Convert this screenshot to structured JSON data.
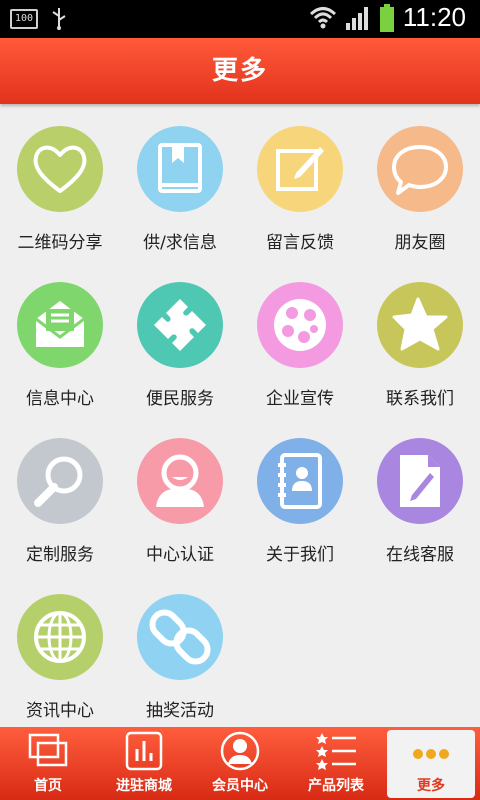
{
  "status": {
    "time": "11:20",
    "battery_small": "100"
  },
  "header": {
    "title": "更多"
  },
  "grid": [
    {
      "label": "二维码分享",
      "icon": "heart-icon",
      "color": "#b8cf6a"
    },
    {
      "label": "供/求信息",
      "icon": "book-icon",
      "color": "#8fd3f0"
    },
    {
      "label": "留言反馈",
      "icon": "edit-icon",
      "color": "#f7d57a"
    },
    {
      "label": "朋友圈",
      "icon": "chat-bubble-icon",
      "color": "#f6b98a"
    },
    {
      "label": "信息中心",
      "icon": "mail-icon",
      "color": "#7fd66c"
    },
    {
      "label": "便民服务",
      "icon": "puzzle-icon",
      "color": "#4fc8b3"
    },
    {
      "label": "企业宣传",
      "icon": "film-reel-icon",
      "color": "#f39ae0"
    },
    {
      "label": "联系我们",
      "icon": "star-icon",
      "color": "#c7c65a"
    },
    {
      "label": "定制服务",
      "icon": "magnifier-icon",
      "color": "#c3c8cf"
    },
    {
      "label": "中心认证",
      "icon": "user-icon",
      "color": "#f79ba8"
    },
    {
      "label": "关于我们",
      "icon": "contacts-icon",
      "color": "#7fb0e8"
    },
    {
      "label": "在线客服",
      "icon": "document-edit-icon",
      "color": "#a987e0"
    },
    {
      "label": "资讯中心",
      "icon": "globe-icon",
      "color": "#b5cf6a"
    },
    {
      "label": "抽奖活动",
      "icon": "link-icon",
      "color": "#8fd2f2"
    }
  ],
  "tabs": [
    {
      "label": "首页",
      "icon": "layers-icon"
    },
    {
      "label": "进驻商城",
      "icon": "bar-chart-icon"
    },
    {
      "label": "会员中心",
      "icon": "member-icon"
    },
    {
      "label": "产品列表",
      "icon": "star-list-icon"
    },
    {
      "label": "更多",
      "icon": "more-dots-icon"
    }
  ]
}
